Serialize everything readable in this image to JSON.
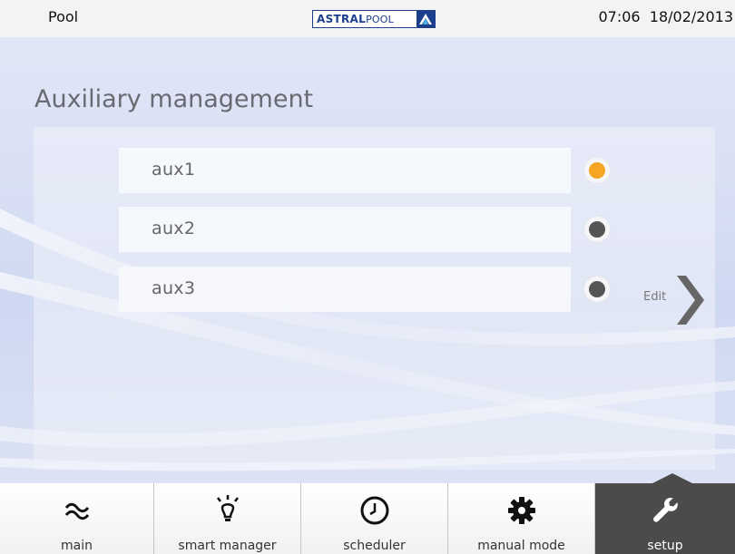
{
  "header": {
    "app_name": "Pool",
    "brand": {
      "bold": "ASTRAL",
      "light": "POOL"
    },
    "time": "07:06",
    "date": "18/02/2013"
  },
  "page": {
    "title": "Auxiliary management"
  },
  "auxiliaries": [
    {
      "label": "aux1",
      "status": "on",
      "indicator_color": "#f5a623"
    },
    {
      "label": "aux2",
      "status": "off",
      "indicator_color": "#555555"
    },
    {
      "label": "aux3",
      "status": "off",
      "indicator_color": "#555555"
    }
  ],
  "edit_button": {
    "label": "Edit",
    "icon": "chevron-right-icon"
  },
  "nav": {
    "active_tab": "setup",
    "tabs": [
      {
        "id": "main",
        "label": "main",
        "icon": "waves-icon"
      },
      {
        "id": "smart-manager",
        "label": "smart manager",
        "icon": "lightbulb-icon"
      },
      {
        "id": "scheduler",
        "label": "scheduler",
        "icon": "clock-icon"
      },
      {
        "id": "manual-mode",
        "label": "manual mode",
        "icon": "gear-icon"
      },
      {
        "id": "setup",
        "label": "setup",
        "icon": "wrench-icon"
      }
    ]
  },
  "colors": {
    "accent_on": "#f5a623",
    "indicator_off": "#555555",
    "brand_blue": "#1b3f8c",
    "active_tab_bg": "#4b4b4b"
  }
}
